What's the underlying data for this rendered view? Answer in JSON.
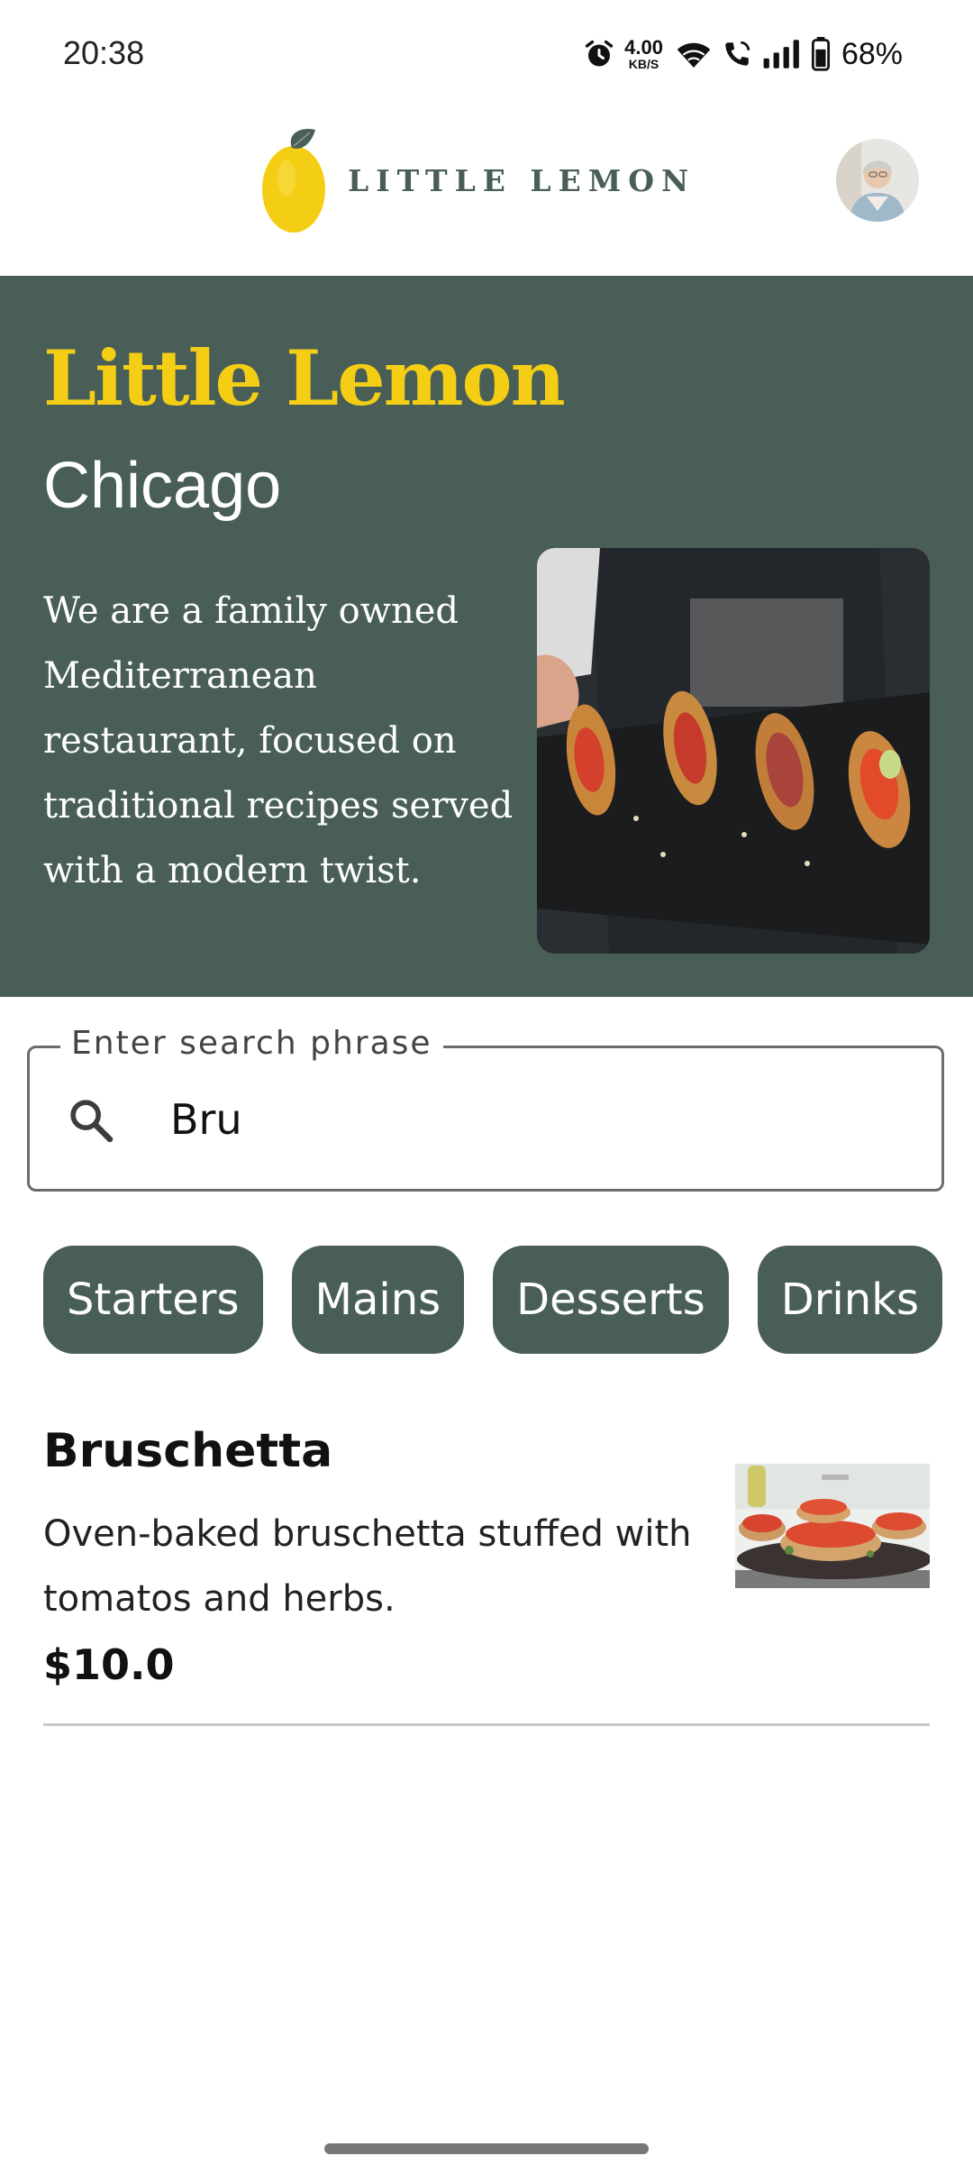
{
  "status_bar": {
    "time": "20:38",
    "net_speed_value": "4.00",
    "net_speed_unit": "KB/S",
    "battery": "68%",
    "icons": [
      "alarm-icon",
      "wifi-icon",
      "wifi-calling-icon",
      "signal-icon",
      "battery-icon"
    ]
  },
  "header": {
    "logo_text": "LITTLE LEMON",
    "avatar": "profile-avatar"
  },
  "hero": {
    "title": "Little Lemon",
    "city": "Chicago",
    "description": "We are a family owned Mediterranean restaurant, focused on traditional recipes served with a modern twist."
  },
  "search": {
    "label": "Enter search phrase",
    "value": "Bru"
  },
  "categories": [
    "Starters",
    "Mains",
    "Desserts",
    "Drinks"
  ],
  "menu_items": [
    {
      "name": "Bruschetta",
      "description": "Oven-baked bruschetta stuffed with tomatos and herbs.",
      "price": "$10.0"
    }
  ],
  "colors": {
    "primary_green": "#495e57",
    "primary_yellow": "#f4ce14"
  }
}
